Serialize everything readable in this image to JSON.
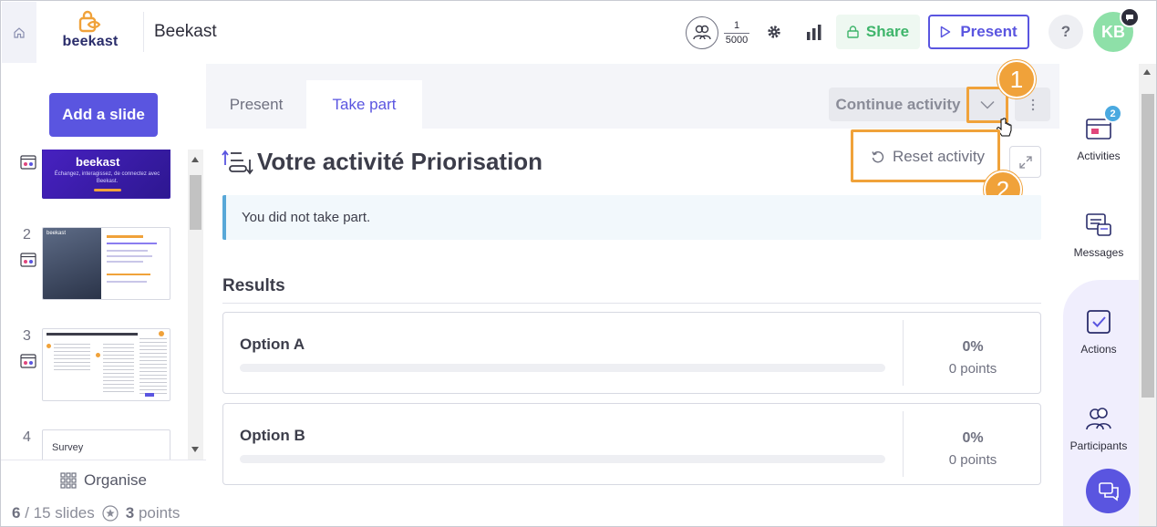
{
  "header": {
    "logo_text": "beekast",
    "app_title": "Beekast",
    "participants": {
      "current": "1",
      "max": "5000"
    },
    "share_label": "Share",
    "present_label": "Present",
    "help_label": "?",
    "avatar_initials": "KB"
  },
  "sidebar": {
    "add_slide_label": "Add a slide",
    "slides": [
      {
        "number": "",
        "thumb_title": "beekast",
        "thumb_subtitle": "Échangez, interagissez, de connectez avec Beekast."
      },
      {
        "number": "2",
        "thumb_title": "beekast"
      },
      {
        "number": "3",
        "thumb_title": ""
      },
      {
        "number": "4",
        "thumb_title": "Survey"
      }
    ],
    "organise_label": "Organise",
    "slides_current": "6",
    "slides_total": "/ 15 slides",
    "points_value": "3",
    "points_label": "points"
  },
  "tabs": [
    {
      "label": "Present"
    },
    {
      "label": "Take part"
    }
  ],
  "activity": {
    "continue_label": "Continue activity",
    "reset_label": "Reset activity",
    "title": "Votre activité Priorisation",
    "info_text": "You did not take part.",
    "results_title": "Results",
    "options": [
      {
        "name": "Option A",
        "percent": "0%",
        "points": "0 points",
        "fraction": 0
      },
      {
        "name": "Option B",
        "percent": "0%",
        "points": "0 points",
        "fraction": 0
      }
    ]
  },
  "annotations": {
    "marker_1": "1",
    "marker_2": "2",
    "color": "#f0a23a"
  },
  "rail": {
    "activities_label": "Activities",
    "activities_badge": "2",
    "messages_label": "Messages",
    "actions_label": "Actions",
    "participants_label": "Participants"
  },
  "colors": {
    "accent": "#5a55e0",
    "share_green": "#3fb56b",
    "info_blue": "#58a8d8"
  }
}
